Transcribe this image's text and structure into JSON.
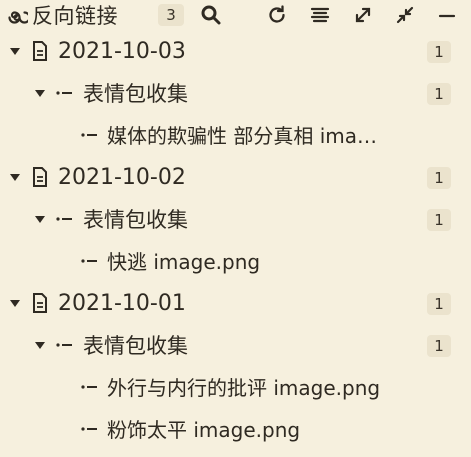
{
  "header": {
    "title": "反向链接",
    "count": "3",
    "icons": {
      "backlinks": "backlink-spiral-icon",
      "search": "search-icon",
      "refresh": "refresh-icon",
      "list": "list-icon",
      "expand": "expand-icon",
      "collapse": "collapse-icon",
      "minimize": "minimize-icon"
    }
  },
  "groups": [
    {
      "date": "2021-10-03",
      "count": "1",
      "category": {
        "label": "表情包收集",
        "count": "1"
      },
      "items": [
        "媒体的欺骗性 部分真相 ima…"
      ]
    },
    {
      "date": "2021-10-02",
      "count": "1",
      "category": {
        "label": "表情包收集",
        "count": "1"
      },
      "items": [
        "快逃 image.png"
      ]
    },
    {
      "date": "2021-10-01",
      "count": "1",
      "category": {
        "label": "表情包收集",
        "count": "1"
      },
      "items": [
        "外行与内行的批评 image.png",
        "粉饰太平 image.png"
      ]
    }
  ],
  "colors": {
    "background": "#f6f0de",
    "text": "#2f2a22",
    "badge": "#ebe3cd"
  }
}
